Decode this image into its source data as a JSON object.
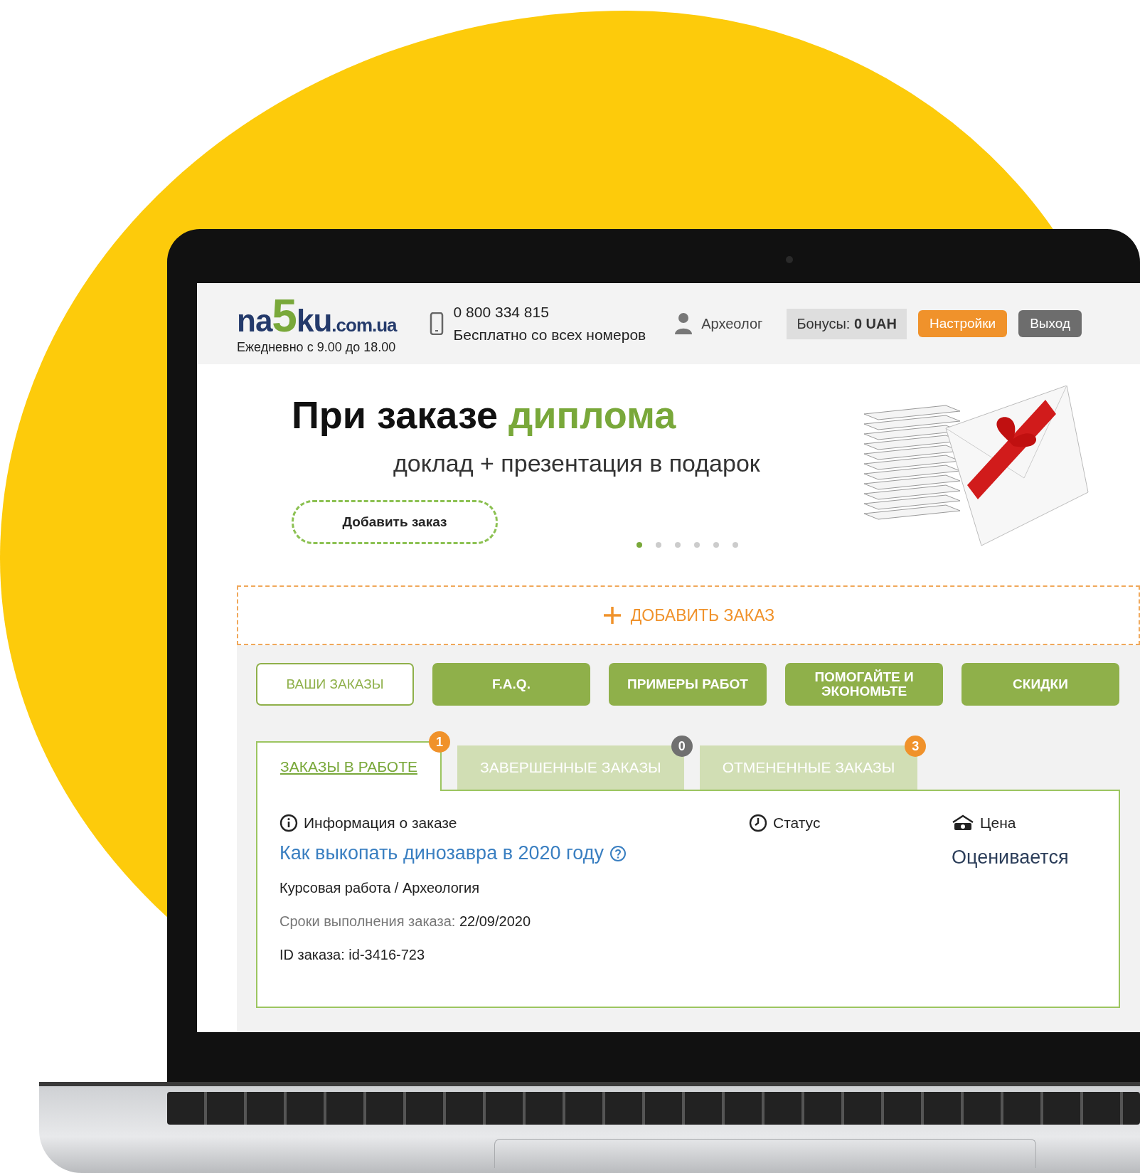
{
  "header": {
    "logo": {
      "parts": [
        "na",
        "5",
        "ku",
        ".com.ua"
      ]
    },
    "hours": "Ежедневно с 9.00 до 18.00",
    "phone": "0 800 334 815",
    "phone_note": "Бесплатно со всех номеров",
    "user": "Археолог",
    "bonus": "Бонусы: **0 UAH**",
    "buttons": [
      {
        "label": "Настройки",
        "kind": "primary"
      },
      {
        "label": "Выход",
        "kind": "secondary"
      }
    ]
  },
  "banner": {
    "headline": "При заказе",
    "headline_highlight": "диплома",
    "subtitle": "доклад + презентация в подарок",
    "button": "Добавить заказ",
    "dots": [
      {
        "selected": true
      },
      {
        "selected": false
      },
      {
        "selected": false
      },
      {
        "selected": false
      },
      {
        "selected": false
      },
      {
        "selected": false
      }
    ]
  },
  "add_order": "ДОБАВИТЬ ЗАКАЗ",
  "nav": [
    {
      "label": "ВАШИ ЗАКАЗЫ",
      "selected": true
    },
    {
      "label": "F.A.Q.",
      "selected": false
    },
    {
      "label": "ПРИМЕРЫ РАБОТ",
      "selected": false
    },
    {
      "label": "ПОМОГАЙТЕ И ЭКОНОМЬТЕ",
      "selected": false
    },
    {
      "label": "СКИДКИ",
      "selected": false
    }
  ],
  "tabs": [
    {
      "label": "ЗАКАЗЫ В РАБОТЕ",
      "selected": true,
      "badge": "1",
      "color": "#f0922b"
    },
    {
      "label": "ЗАВЕРШЕННЫЕ ЗАКАЗЫ",
      "selected": false,
      "badge": "0",
      "color": "#707070"
    },
    {
      "label": "ОТМЕНЕННЫЕ ЗАКАЗЫ",
      "selected": false,
      "badge": "3",
      "color": "#f0922b"
    }
  ],
  "order": {
    "columns": [
      {
        "label": "Информация о заказе",
        "kind": "info"
      },
      {
        "label": "Статус",
        "kind": "status"
      },
      {
        "label": "Цена",
        "kind": "price"
      }
    ],
    "title": "Как выкопать динозавра в 2020 году",
    "type": "Курсовая работа / Археология",
    "deadline_label": "Сроки выполнения заказа:",
    "deadline": "22/09/2020",
    "id_line": "ID заказа: id-3416-723",
    "price": "Оценивается"
  }
}
